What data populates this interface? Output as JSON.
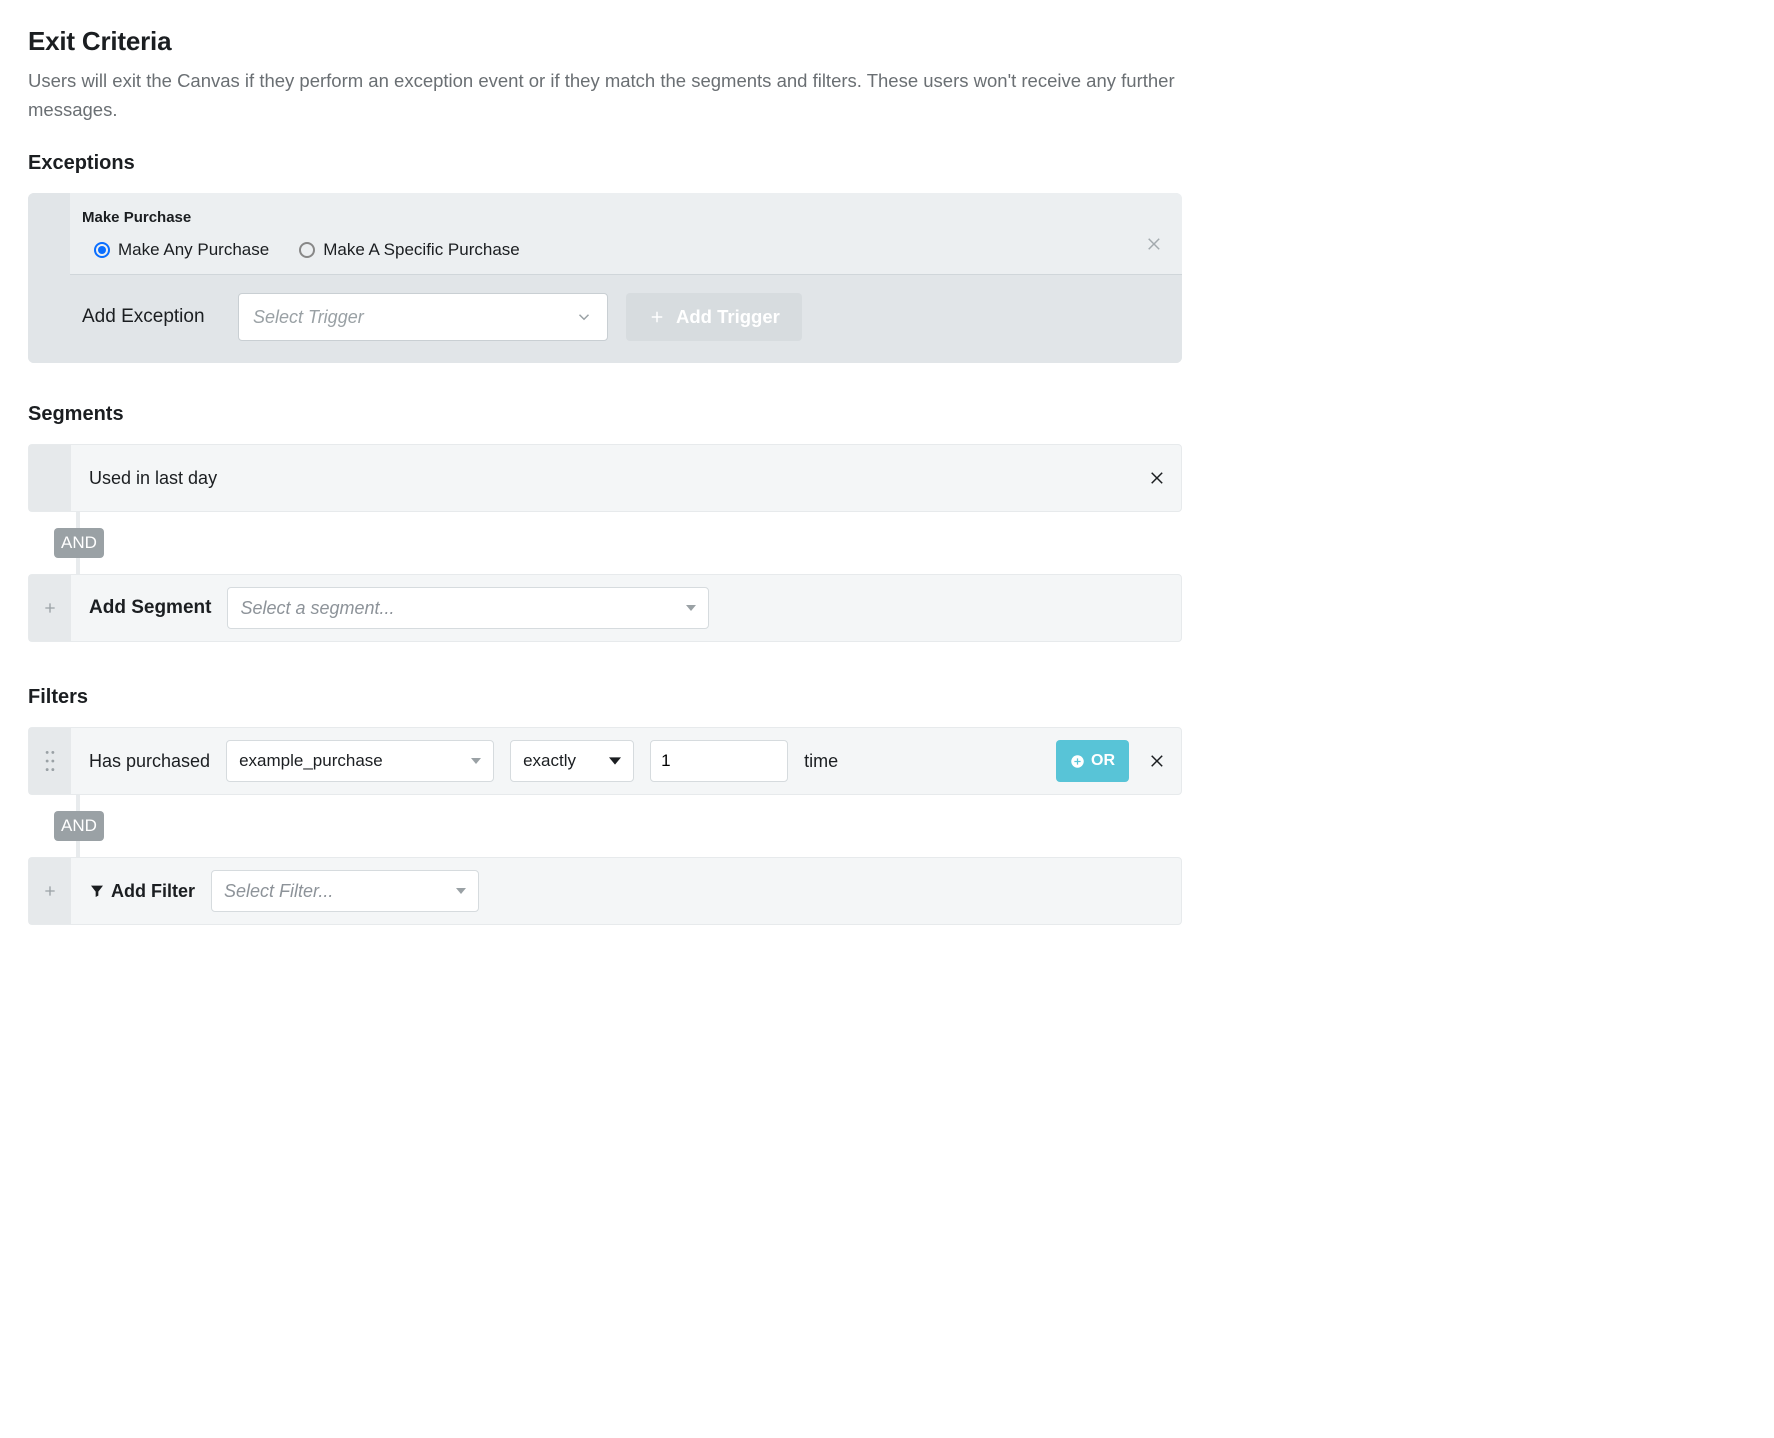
{
  "title": "Exit Criteria",
  "description": "Users will exit the Canvas if they perform an exception event or if they match the segments and filters. These users won't receive any further messages.",
  "exceptions": {
    "heading": "Exceptions",
    "item_title": "Make Purchase",
    "radios": {
      "any": "Make Any Purchase",
      "specific": "Make A Specific Purchase"
    },
    "add_label": "Add Exception",
    "select_placeholder": "Select Trigger",
    "add_trigger_label": "Add Trigger"
  },
  "segments": {
    "heading": "Segments",
    "row0_text": "Used in last day",
    "connector": "AND",
    "add_label": "Add Segment",
    "select_placeholder": "Select a segment..."
  },
  "filters": {
    "heading": "Filters",
    "prefix": "Has purchased",
    "product": "example_purchase",
    "operator": "exactly",
    "count": "1",
    "suffix": "time",
    "or_label": "OR",
    "connector": "AND",
    "add_label": "Add Filter",
    "select_placeholder": "Select Filter..."
  }
}
